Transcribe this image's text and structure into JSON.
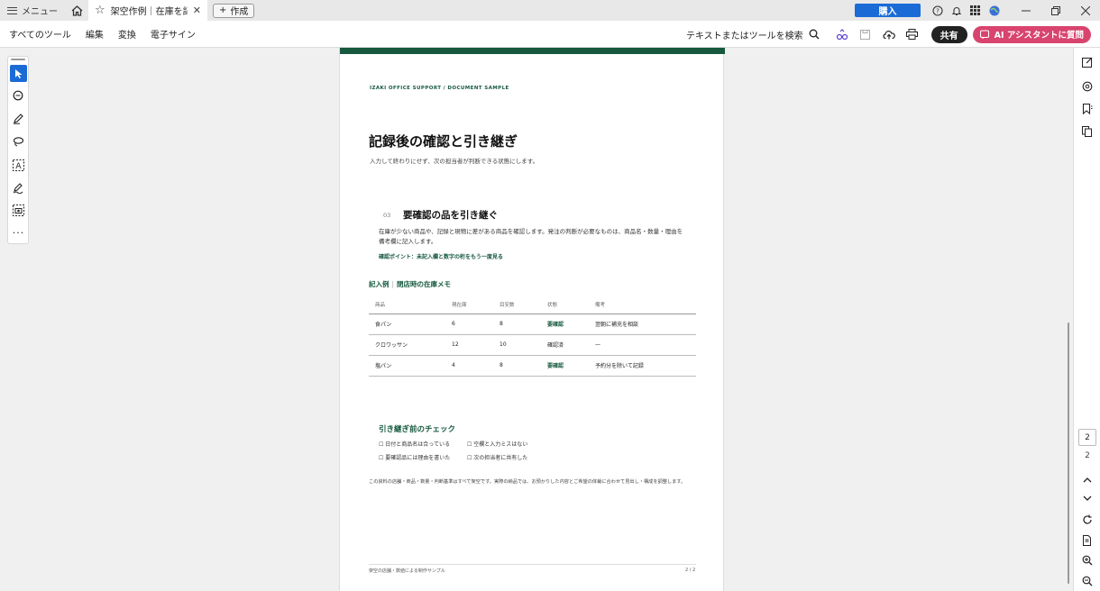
{
  "titlebar": {
    "menu_label": "メニュー",
    "tab_title": "架空作例｜在庫を記...",
    "new_tab_label": "作成",
    "buy_label": "購入"
  },
  "toolbar": {
    "menus": [
      "すべてのツール",
      "編集",
      "変換",
      "電子サイン"
    ],
    "search_label": "テキストまたはツールを検索",
    "share_label": "共有",
    "ai_label": "AI アシスタントに質問"
  },
  "document": {
    "kicker": "IZAKI OFFICE SUPPORT / DOCUMENT SAMPLE",
    "title": "記録後の確認と引き継ぎ",
    "subtitle": "入力して終わりにせず、次の担当者が判断できる状態にします。",
    "section": {
      "number": "03",
      "title": "要確認の品を引き継ぐ",
      "body": "在庫が少ない商品や、記録と現物に差がある商品を確認します。発注の判断が必要なものは、商品名・数量・理由を備考欄に記入します。",
      "point": "確認ポイント：未記入欄と数字の桁をもう一度見る"
    },
    "example": {
      "label": "記入例",
      "separator": "|",
      "title": "閉店時の在庫メモ"
    },
    "table": {
      "headers": [
        "商品",
        "現在庫",
        "目安数",
        "状態",
        "備考"
      ],
      "rows": [
        [
          "食パン",
          "6",
          "8",
          "要確認",
          "翌朝に補充を相談"
        ],
        [
          "クロワッサン",
          "12",
          "10",
          "確認済",
          "—"
        ],
        [
          "塩パン",
          "4",
          "8",
          "要確認",
          "予約分を除いて記録"
        ]
      ]
    },
    "checklist": {
      "title": "引き継ぎ前のチェック",
      "items": [
        "☐ 日付と商品名は合っている",
        "☐ 空欄と入力ミスはない",
        "☐ 要確認品には理由を書いた",
        "☐ 次の担当者に共有した"
      ]
    },
    "disclaimer": "この資料の店舗・商品・数量・判断基準はすべて架空です。実際の納品では、お預かりした内容とご希望の体裁に合わせて見出し・構成を調整します。",
    "footer_left": "架空の店舗・数値による制作サンプル",
    "footer_right": "2 / 2"
  },
  "pager": {
    "current_page": "2",
    "total_pages": "2"
  },
  "colors": {
    "accent_blue": "#1b6bd6",
    "brand_green": "#16593f",
    "ai_pink": "#d8446e"
  }
}
